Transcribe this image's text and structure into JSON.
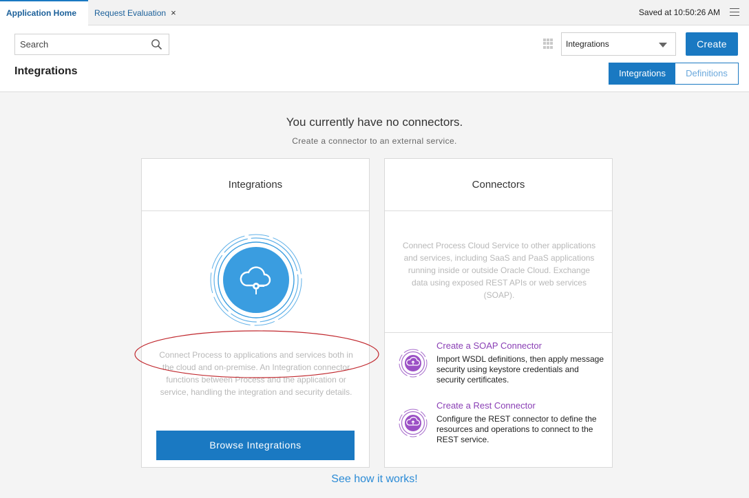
{
  "tabs": {
    "active": "Application Home",
    "second": "Request Evaluation",
    "close_glyph": "×"
  },
  "header": {
    "saved_status": "Saved at 10:50:26 AM"
  },
  "toolbar": {
    "search_placeholder": "Search",
    "selected_option": "Integrations",
    "create_label": "Create"
  },
  "page": {
    "title": "Integrations",
    "toggle": {
      "on": "Integrations",
      "off": "Definitions"
    }
  },
  "empty_state": {
    "title": "You currently have no connectors.",
    "subtitle": "Create a connector to an external service."
  },
  "integrations_card": {
    "heading": "Integrations",
    "description": "Connect Process to applications and services both in the cloud and on-premise. An Integration connector functions between Process and the application or service, handling the integration and security details.",
    "button": "Browse Integrations"
  },
  "connectors_card": {
    "heading": "Connectors",
    "description": "Connect Process Cloud Service to other applications and services, including SaaS and PaaS applications running inside or outside Oracle Cloud. Exchange data using exposed REST APIs or web services (SOAP).",
    "items": [
      {
        "title": "Create a SOAP Connector",
        "description": "Import WSDL definitions, then apply message security using keystore credentials and security certificates."
      },
      {
        "title": "Create a Rest Connector",
        "description": "Configure the REST connector to define the resources and operations to connect to the REST service."
      }
    ]
  },
  "footer_link": "See how it works!",
  "colors": {
    "accent": "#1a79c2",
    "connector_purple": "#8a3fb5",
    "highlight_ellipse": "#c0272d"
  },
  "icons": [
    "search-icon",
    "grid-icon",
    "menu-icon",
    "close-icon",
    "cloud-integration-icon",
    "cloud-connector-icon"
  ]
}
